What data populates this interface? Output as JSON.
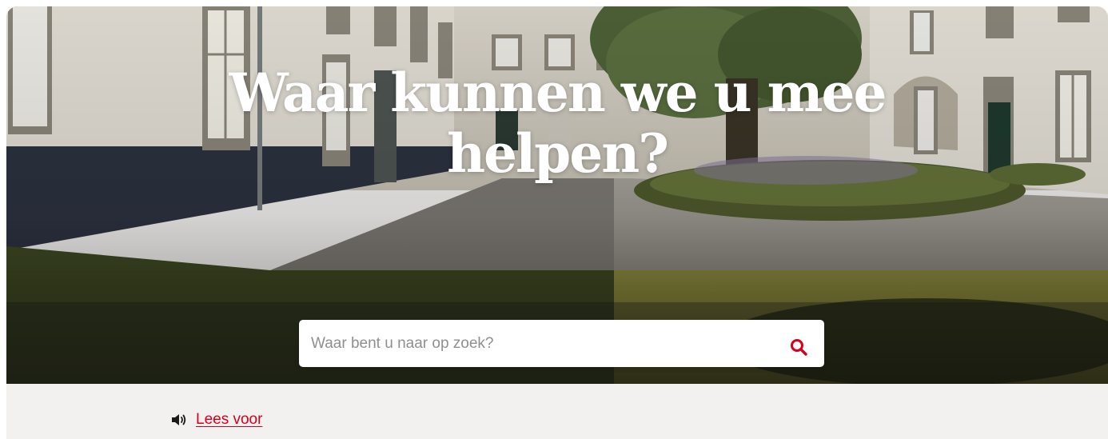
{
  "hero": {
    "title_line1": "Waar kunnen we u mee",
    "title_line2": "helpen?"
  },
  "search": {
    "placeholder": "Waar bent u naar op zoek?",
    "button_icon": "search-icon"
  },
  "read_aloud": {
    "icon": "speaker-icon",
    "label": "Lees voor"
  },
  "colors": {
    "accent": "#d5001c",
    "footer_background": "#f2f1ef",
    "search_background": "#ffffff"
  }
}
